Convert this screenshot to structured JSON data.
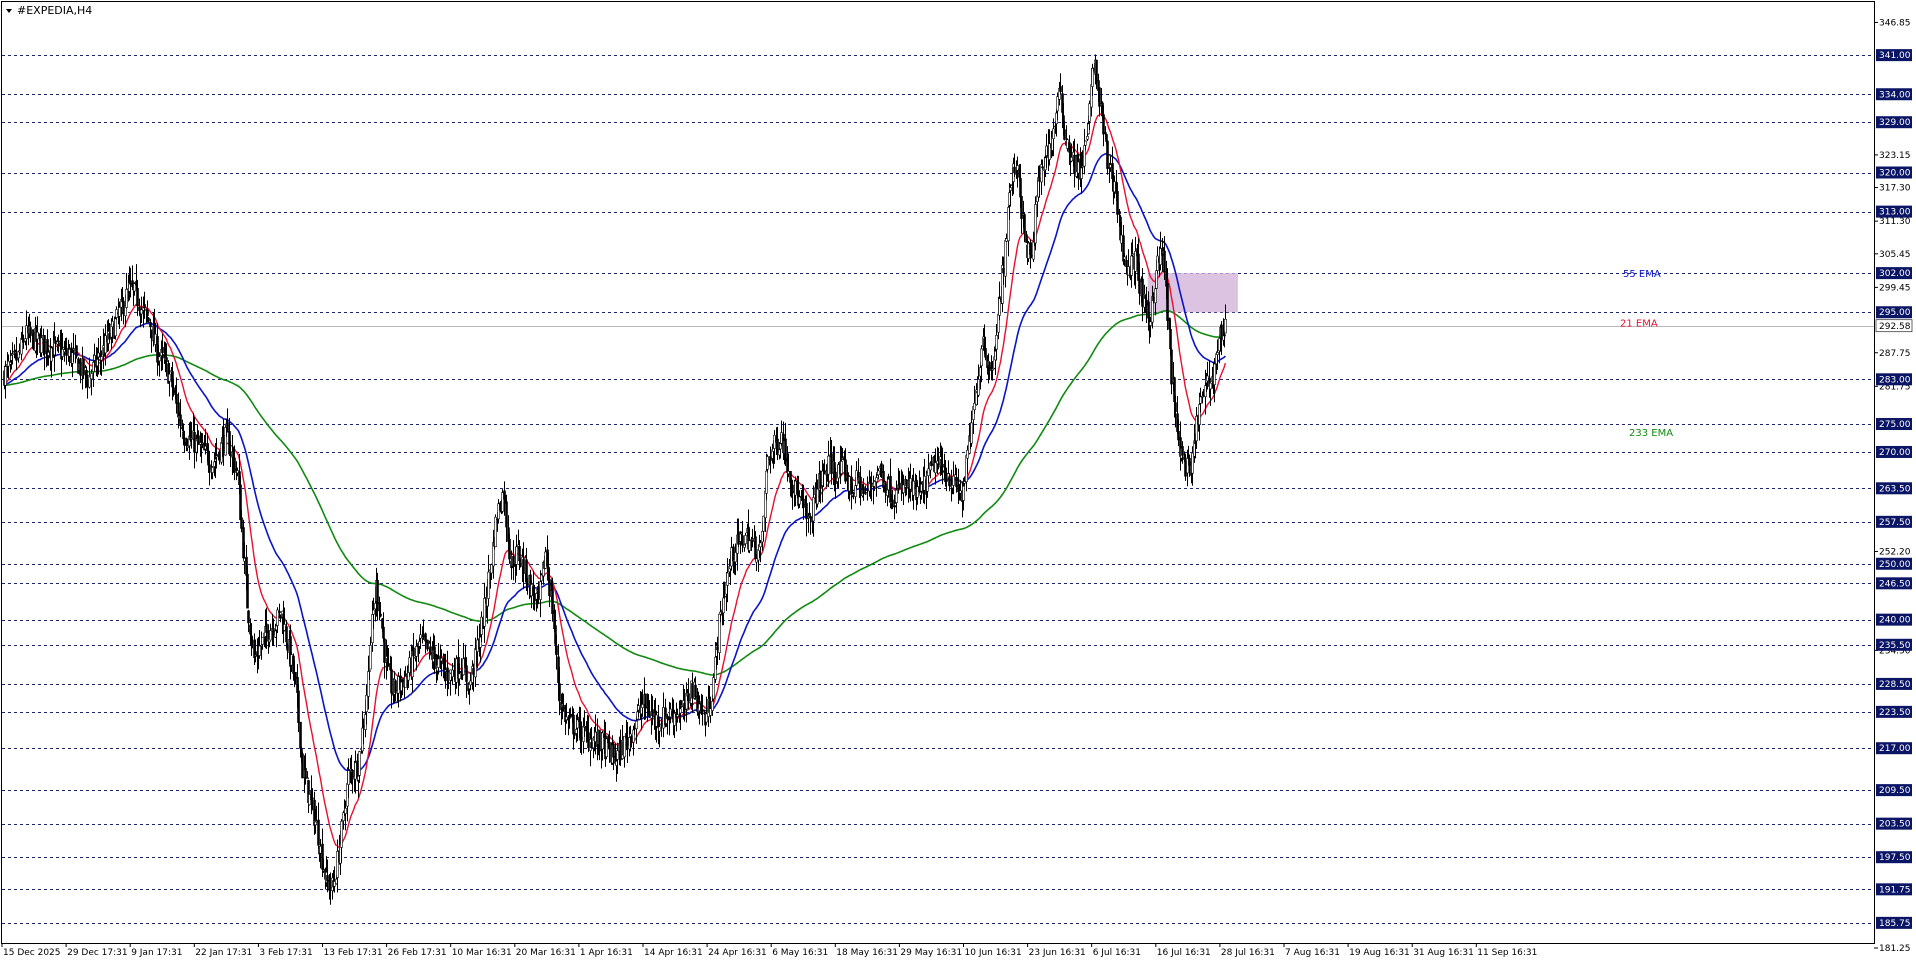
{
  "window": {
    "title": "#EXPEDIA,H4"
  },
  "colors": {
    "ema21": "#e8102e",
    "ema55": "#0a14c8",
    "ema233": "#118a11",
    "level_line": "#1d2470",
    "label_bg": "#0b1565",
    "zone": "#d7b9dd",
    "candle": "#000000",
    "current_line": "#b8b8b8"
  },
  "chart_data": {
    "type": "candlestick",
    "symbol": "#EXPEDIA",
    "timeframe": "H4",
    "ylim": [
      180.0,
      348.0
    ],
    "right_axis_ticks": [
      "346.85",
      "341.00",
      "334.00",
      "329.00",
      "323.15",
      "320.00",
      "317.30",
      "313.00",
      "311.30",
      "305.45",
      "302.00",
      "299.45",
      "295.00",
      "292.58",
      "287.75",
      "283.00",
      "281.75",
      "275.00",
      "270.00",
      "263.50",
      "257.50",
      "252.20",
      "250.00",
      "246.50",
      "240.00",
      "235.50",
      "234.50",
      "228.50",
      "223.50",
      "217.00",
      "209.50",
      "203.50",
      "197.50",
      "191.75",
      "185.75",
      "181.25"
    ],
    "levels": [
      341.0,
      334.0,
      329.0,
      320.0,
      313.0,
      302.0,
      295.0,
      283.0,
      275.0,
      270.0,
      263.5,
      257.5,
      250.0,
      246.5,
      240.0,
      235.5,
      228.5,
      223.5,
      217.0,
      209.5,
      203.5,
      197.5,
      191.75,
      185.75
    ],
    "current_price": 292.58,
    "x_labels": [
      "15 Dec 2025",
      "29 Dec 17:31",
      "9 Jan 17:31",
      "22 Jan 17:31",
      "3 Feb 17:31",
      "13 Feb 17:31",
      "26 Feb 17:31",
      "10 Mar 16:31",
      "20 Mar 16:31",
      "1 Apr 16:31",
      "14 Apr 16:31",
      "24 Apr 16:31",
      "6 May 16:31",
      "18 May 16:31",
      "29 May 16:31",
      "10 Jun 16:31",
      "23 Jun 16:31",
      "6 Jul 16:31",
      "16 Jul 16:31",
      "28 Jul 16:31",
      "7 Aug 16:31",
      "19 Aug 16:31",
      "31 Aug 16:31",
      "11 Sep 16:31"
    ],
    "zone": {
      "price_low": 295.0,
      "price_high": 302.0
    },
    "ema_labels": {
      "ema21": "21 EMA",
      "ema55": "55 EMA",
      "ema233": "233 EMA"
    },
    "close_path": [
      [
        0,
        284
      ],
      [
        10,
        287
      ],
      [
        15,
        291
      ],
      [
        30,
        289
      ],
      [
        50,
        287
      ],
      [
        60,
        283
      ],
      [
        75,
        290
      ],
      [
        85,
        296
      ],
      [
        90,
        299
      ],
      [
        95,
        298
      ],
      [
        100,
        295
      ],
      [
        105,
        293
      ],
      [
        110,
        288
      ],
      [
        115,
        286
      ],
      [
        120,
        283
      ],
      [
        125,
        277
      ],
      [
        130,
        273
      ],
      [
        140,
        271
      ],
      [
        150,
        268
      ],
      [
        160,
        273
      ],
      [
        168,
        266
      ],
      [
        175,
        243
      ],
      [
        180,
        233
      ],
      [
        190,
        238
      ],
      [
        200,
        241
      ],
      [
        210,
        228
      ],
      [
        215,
        213
      ],
      [
        225,
        203
      ],
      [
        232,
        193
      ],
      [
        237,
        192
      ],
      [
        242,
        200
      ],
      [
        248,
        212
      ],
      [
        255,
        214
      ],
      [
        260,
        224
      ],
      [
        265,
        239
      ],
      [
        268,
        246
      ],
      [
        270,
        243
      ],
      [
        275,
        232
      ],
      [
        280,
        227
      ],
      [
        290,
        230
      ],
      [
        300,
        236
      ],
      [
        310,
        233
      ],
      [
        320,
        230
      ],
      [
        330,
        232
      ],
      [
        335,
        228
      ],
      [
        340,
        234
      ],
      [
        345,
        240
      ],
      [
        350,
        249
      ],
      [
        355,
        259
      ],
      [
        360,
        263
      ],
      [
        365,
        250
      ],
      [
        370,
        252
      ],
      [
        375,
        249
      ],
      [
        380,
        245
      ],
      [
        385,
        243
      ],
      [
        390,
        252
      ],
      [
        395,
        242
      ],
      [
        400,
        226
      ],
      [
        405,
        222
      ],
      [
        410,
        221
      ],
      [
        420,
        219
      ],
      [
        430,
        218
      ],
      [
        440,
        215
      ],
      [
        450,
        219
      ],
      [
        460,
        225
      ],
      [
        470,
        222
      ],
      [
        480,
        223
      ],
      [
        490,
        224
      ],
      [
        495,
        228
      ],
      [
        500,
        225
      ],
      [
        505,
        222
      ],
      [
        510,
        227
      ],
      [
        515,
        239
      ],
      [
        520,
        247
      ],
      [
        525,
        252
      ],
      [
        530,
        254
      ],
      [
        535,
        255
      ],
      [
        540,
        253
      ],
      [
        545,
        252
      ],
      [
        550,
        269
      ],
      [
        555,
        271
      ],
      [
        560,
        273
      ],
      [
        565,
        267
      ],
      [
        570,
        263
      ],
      [
        575,
        260
      ],
      [
        580,
        257
      ],
      [
        585,
        263
      ],
      [
        590,
        266
      ],
      [
        595,
        268
      ],
      [
        600,
        266
      ],
      [
        605,
        267
      ],
      [
        610,
        263
      ],
      [
        615,
        265
      ],
      [
        620,
        262
      ],
      [
        630,
        267
      ],
      [
        640,
        262
      ],
      [
        650,
        264
      ],
      [
        660,
        262
      ],
      [
        670,
        268
      ],
      [
        680,
        266
      ],
      [
        690,
        262
      ],
      [
        700,
        280
      ],
      [
        705,
        291
      ],
      [
        710,
        284
      ],
      [
        715,
        291
      ],
      [
        720,
        304
      ],
      [
        725,
        318
      ],
      [
        730,
        322
      ],
      [
        735,
        308
      ],
      [
        740,
        304
      ],
      [
        745,
        318
      ],
      [
        750,
        323
      ],
      [
        755,
        326
      ],
      [
        760,
        334
      ],
      [
        765,
        326
      ],
      [
        770,
        322
      ],
      [
        775,
        320
      ],
      [
        780,
        326
      ],
      [
        785,
        340
      ],
      [
        790,
        331
      ],
      [
        795,
        322
      ],
      [
        800,
        318
      ],
      [
        805,
        307
      ],
      [
        810,
        302
      ],
      [
        815,
        305
      ],
      [
        820,
        297
      ],
      [
        825,
        293
      ],
      [
        830,
        303
      ],
      [
        835,
        306
      ],
      [
        840,
        287
      ],
      [
        845,
        273
      ],
      [
        850,
        268
      ],
      [
        855,
        266
      ],
      [
        860,
        277
      ],
      [
        865,
        281
      ],
      [
        870,
        283
      ],
      [
        875,
        290
      ],
      [
        880,
        293
      ]
    ]
  }
}
